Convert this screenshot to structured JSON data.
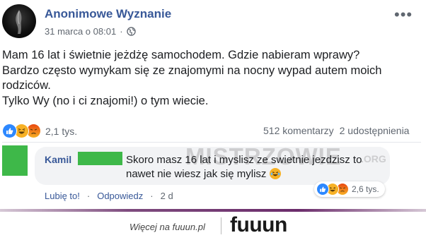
{
  "post": {
    "author": "Anonimowe Wyznanie",
    "timestamp": "31 marca o 08:01",
    "privacy_icon": "globe-icon",
    "more_label": "•••",
    "body": [
      "Mam 16 lat i świetnie jeżdżę samochodem. Gdzie nabieram wprawy?",
      "Bardzo często wymykam się ze znajomymi na nocny wypad autem moich rodziców.",
      "Tylko Wy (no i ci znajomi!) o tym wiecie."
    ],
    "reactions": {
      "icons": [
        "like-icon",
        "haha-icon",
        "angry-icon"
      ],
      "count": "2,1 tys."
    },
    "comments_count": "512 komentarzy",
    "shares_count": "2 udostępnienia"
  },
  "comment": {
    "author": "Kamil",
    "text": "Skoro masz 16 lat i myslisz ze swietnie jezdzisz to nawet nie wiesz jak się mylisz",
    "emoji": "haha-emoji",
    "actions": {
      "like": "Lubię to!",
      "separator1": "·",
      "reply": "Odpowiedz",
      "separator2": "·",
      "time": "2 d"
    },
    "reactions": {
      "icons": [
        "like-icon",
        "haha-icon",
        "angry-icon"
      ],
      "count": "2,6 tys."
    }
  },
  "watermark": {
    "main": "MISTRZOWIE",
    "suffix": ".ORG"
  },
  "footer": {
    "text": "Więcej na fuuun.pl",
    "logo": "fuuun"
  },
  "colors": {
    "link": "#385898",
    "redaction": "#3eb849",
    "like": "#2d88ff",
    "haha": "#f7b125",
    "angry": "#e9710f",
    "brand_accent": "#6b2c6b"
  }
}
